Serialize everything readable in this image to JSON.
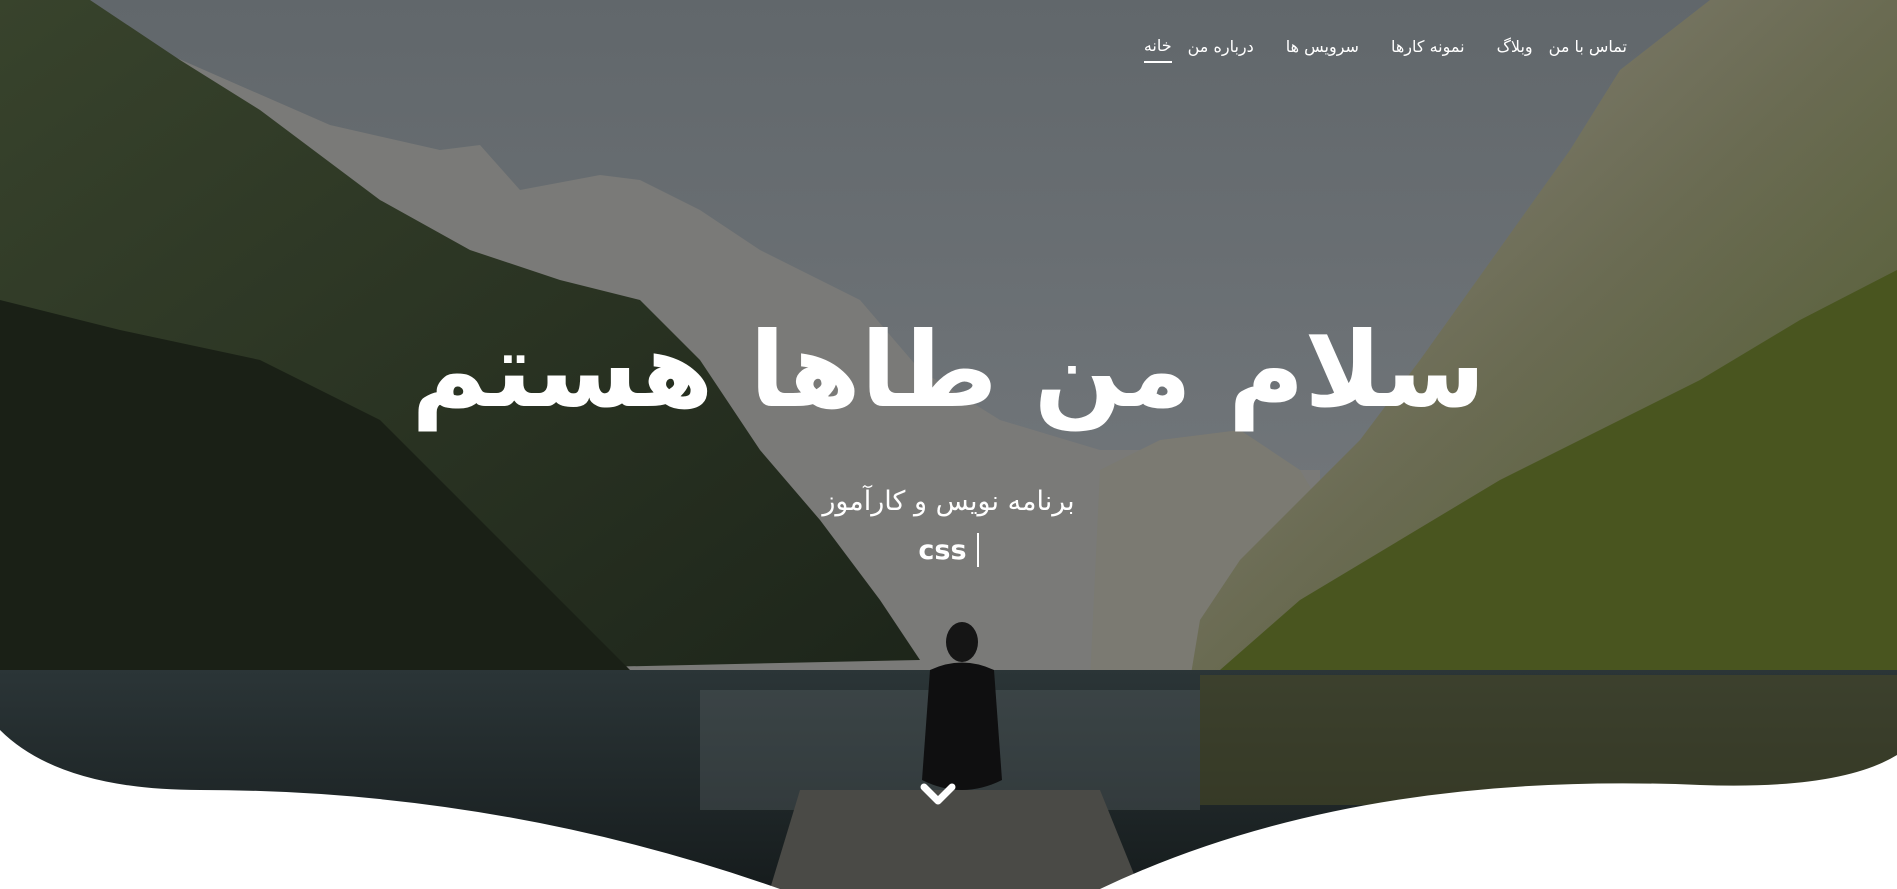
{
  "nav": {
    "items": [
      {
        "label": "خانه",
        "active": true
      },
      {
        "label": "درباره من",
        "active": false
      },
      {
        "label": "سرویس ها",
        "active": false
      },
      {
        "label": "نمونه کارها",
        "active": false
      },
      {
        "label": "وبلاگ",
        "active": false
      },
      {
        "label": "تماس با من",
        "active": false
      }
    ]
  },
  "hero": {
    "title": "سلام من طاها هستم",
    "subtitle": "برنامه نویس و کارآموز",
    "typed_text": "css"
  },
  "scroll_down": {
    "icon": "chevron-down-icon"
  },
  "colors": {
    "text": "#ffffff",
    "sky": "#6b7074",
    "mountain_shadow": "#2c3328",
    "forest": "#3f4a26",
    "lake": "#1f2a2c",
    "wave": "#ffffff"
  }
}
